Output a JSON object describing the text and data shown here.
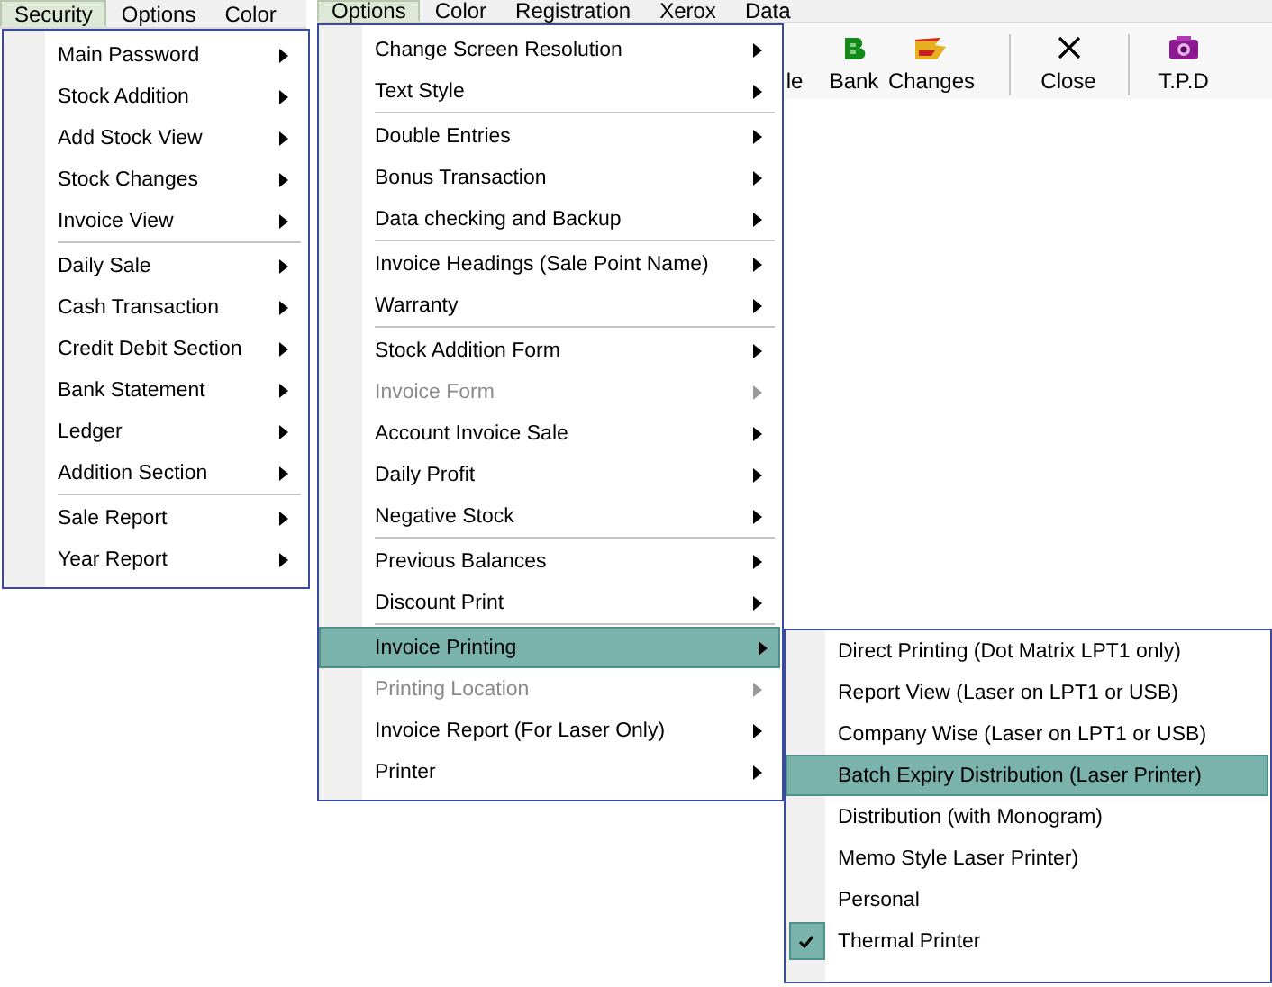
{
  "menubars": [
    {
      "items": [
        {
          "label": "Security",
          "selected": true
        },
        {
          "label": "Options",
          "selected": false
        },
        {
          "label": "Color",
          "selected": false
        }
      ]
    },
    {
      "items": [
        {
          "label": "Options",
          "selected": true
        },
        {
          "label": "Color",
          "selected": false
        },
        {
          "label": "Registration",
          "selected": false
        },
        {
          "label": "Xerox",
          "selected": false
        },
        {
          "label": "Data",
          "selected": false
        }
      ]
    }
  ],
  "toolbar": {
    "buttons": [
      {
        "kind": "partial",
        "label": "le"
      },
      {
        "kind": "bank",
        "label": "Bank"
      },
      {
        "kind": "changes",
        "label": "Changes"
      },
      {
        "kind": "separator"
      },
      {
        "kind": "close",
        "label": "Close"
      },
      {
        "kind": "separator"
      },
      {
        "kind": "tpd",
        "label": "T.P.D"
      }
    ]
  },
  "menus": [
    {
      "items": [
        {
          "kind": "item",
          "label": "Main Password",
          "submenu": true
        },
        {
          "kind": "item",
          "label": "Stock Addition",
          "submenu": true
        },
        {
          "kind": "item",
          "label": "Add Stock View",
          "submenu": true
        },
        {
          "kind": "item",
          "label": "Stock Changes",
          "submenu": true
        },
        {
          "kind": "item",
          "label": "Invoice View",
          "submenu": true
        },
        {
          "kind": "separator"
        },
        {
          "kind": "item",
          "label": "Daily Sale",
          "submenu": true
        },
        {
          "kind": "item",
          "label": "Cash Transaction",
          "submenu": true
        },
        {
          "kind": "item",
          "label": "Credit Debit Section",
          "submenu": true
        },
        {
          "kind": "item",
          "label": "Bank Statement",
          "submenu": true
        },
        {
          "kind": "item",
          "label": "Ledger",
          "submenu": true
        },
        {
          "kind": "item",
          "label": "Addition Section",
          "submenu": true
        },
        {
          "kind": "separator"
        },
        {
          "kind": "item",
          "label": "Sale Report",
          "submenu": true
        },
        {
          "kind": "item",
          "label": "Year Report",
          "submenu": true
        }
      ]
    },
    {
      "items": [
        {
          "kind": "item",
          "label": "Change Screen Resolution",
          "submenu": true,
          "disabled": false,
          "selected": false
        },
        {
          "kind": "item",
          "label": "Text Style",
          "submenu": true,
          "disabled": false,
          "selected": false
        },
        {
          "kind": "separator"
        },
        {
          "kind": "item",
          "label": "Double Entries",
          "submenu": true,
          "disabled": false,
          "selected": false
        },
        {
          "kind": "item",
          "label": "Bonus Transaction",
          "submenu": true,
          "disabled": false,
          "selected": false
        },
        {
          "kind": "item",
          "label": "Data checking and Backup",
          "submenu": true,
          "disabled": false,
          "selected": false
        },
        {
          "kind": "separator"
        },
        {
          "kind": "item",
          "label": "Invoice Headings (Sale Point Name)",
          "submenu": true,
          "disabled": false,
          "selected": false
        },
        {
          "kind": "item",
          "label": "Warranty",
          "submenu": true,
          "disabled": false,
          "selected": false
        },
        {
          "kind": "separator"
        },
        {
          "kind": "item",
          "label": "Stock Addition Form",
          "submenu": true,
          "disabled": false,
          "selected": false
        },
        {
          "kind": "item",
          "label": "Invoice Form",
          "submenu": true,
          "disabled": true,
          "selected": false
        },
        {
          "kind": "item",
          "label": "Account Invoice Sale",
          "submenu": true,
          "disabled": false,
          "selected": false
        },
        {
          "kind": "item",
          "label": "Daily Profit",
          "submenu": true,
          "disabled": false,
          "selected": false
        },
        {
          "kind": "item",
          "label": "Negative Stock",
          "submenu": true,
          "disabled": false,
          "selected": false
        },
        {
          "kind": "separator"
        },
        {
          "kind": "item",
          "label": "Previous Balances",
          "submenu": true,
          "disabled": false,
          "selected": false
        },
        {
          "kind": "item",
          "label": "Discount Print",
          "submenu": true,
          "disabled": false,
          "selected": false
        },
        {
          "kind": "separator"
        },
        {
          "kind": "item",
          "label": "Invoice Printing",
          "submenu": true,
          "disabled": false,
          "selected": true
        },
        {
          "kind": "item",
          "label": "Printing Location",
          "submenu": true,
          "disabled": true,
          "selected": false
        },
        {
          "kind": "item",
          "label": "Invoice Report (For Laser Only)",
          "submenu": true,
          "disabled": false,
          "selected": false
        },
        {
          "kind": "item",
          "label": "Printer",
          "submenu": true,
          "disabled": false,
          "selected": false
        }
      ]
    },
    {
      "items": [
        {
          "kind": "item",
          "label": "Direct Printing (Dot Matrix LPT1 only)",
          "selected": false,
          "checked": false
        },
        {
          "kind": "item",
          "label": "Report View (Laser on LPT1 or USB)",
          "selected": false,
          "checked": false
        },
        {
          "kind": "item",
          "label": "Company Wise (Laser on LPT1 or USB)",
          "selected": false,
          "checked": false
        },
        {
          "kind": "item",
          "label": "Batch Expiry Distribution (Laser Printer)",
          "selected": true,
          "checked": false
        },
        {
          "kind": "item",
          "label": "Distribution (with Monogram)",
          "selected": false,
          "checked": false
        },
        {
          "kind": "item",
          "label": "Memo Style Laser Printer)",
          "selected": false,
          "checked": false
        },
        {
          "kind": "item",
          "label": "Personal",
          "selected": false,
          "checked": false
        },
        {
          "kind": "item",
          "label": "Thermal Printer",
          "selected": false,
          "checked": true
        }
      ]
    }
  ]
}
